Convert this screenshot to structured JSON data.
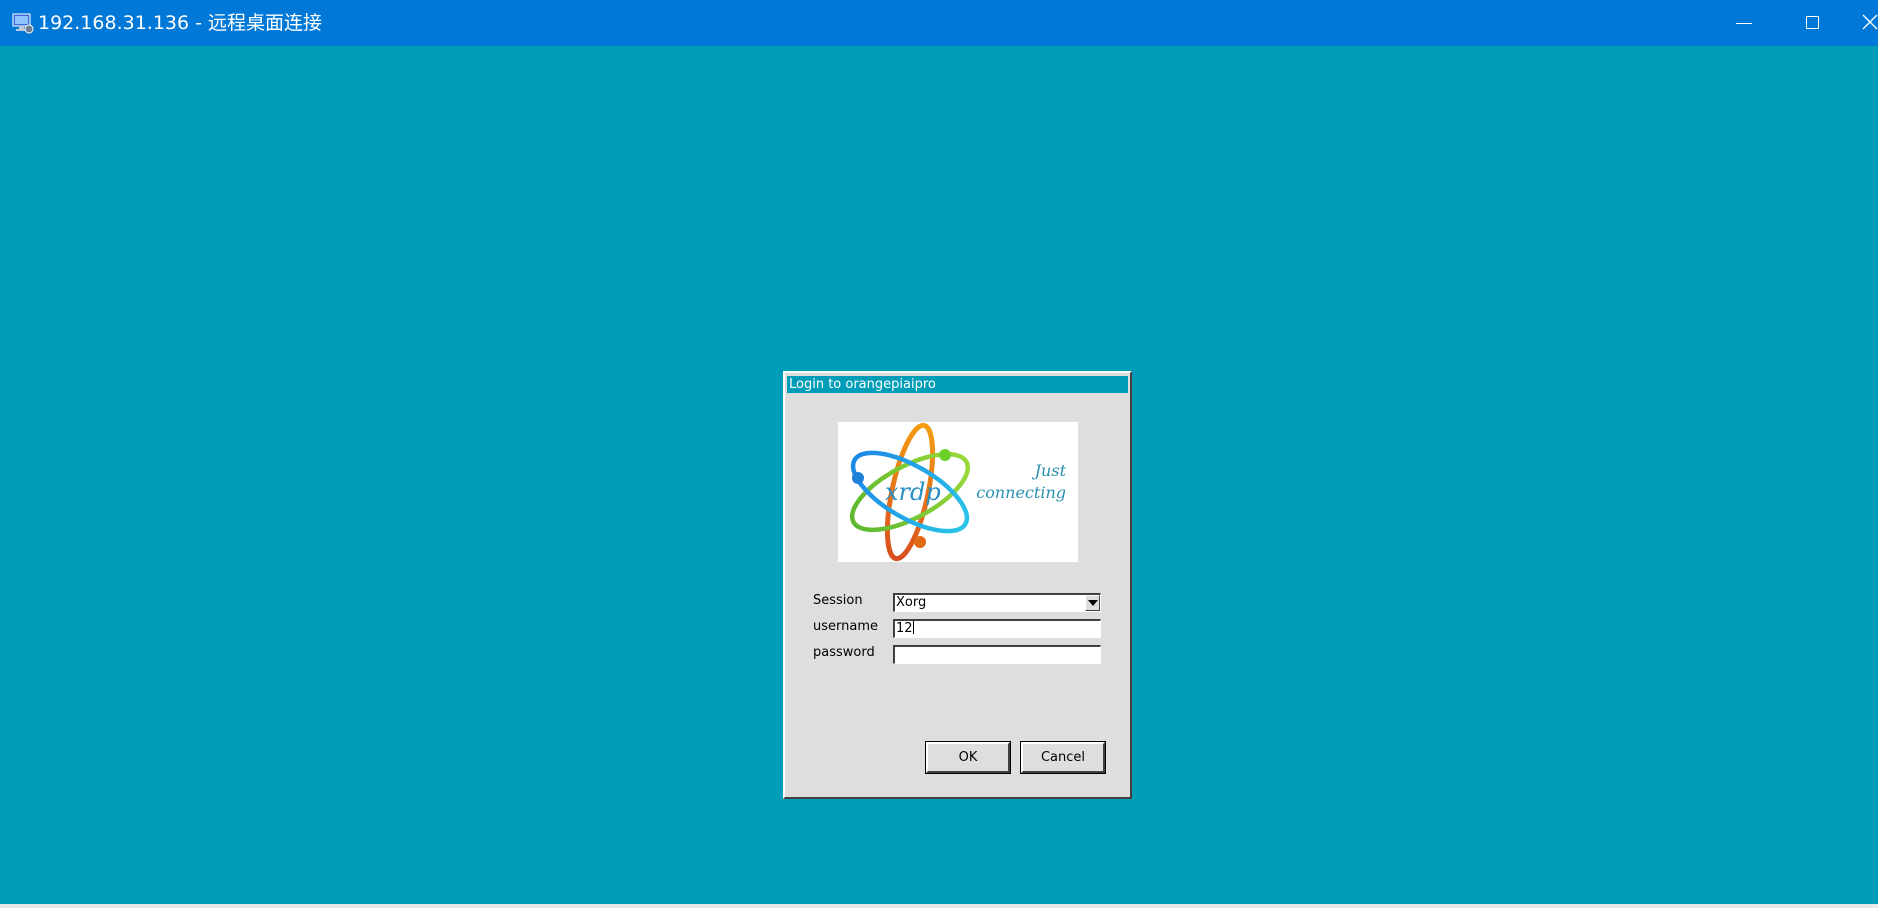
{
  "window": {
    "title": "192.168.31.136 - 远程桌面连接",
    "icon": "remote-desktop-icon",
    "titlebar_color": "#0078d7",
    "desktop_color": "#009db8"
  },
  "window_controls": {
    "minimize": "minimize-icon",
    "maximize": "maximize-icon",
    "close": "close-icon"
  },
  "dialog": {
    "title": "Login to orangepiaipro",
    "logo": {
      "text": "xrdp",
      "tagline_line1": "Just",
      "tagline_line2": "connecting"
    },
    "fields": {
      "session": {
        "label": "Session",
        "value": "Xorg"
      },
      "username": {
        "label": "username",
        "value": "12"
      },
      "password": {
        "label": "password",
        "value": ""
      }
    },
    "buttons": {
      "ok": "OK",
      "cancel": "Cancel"
    }
  }
}
